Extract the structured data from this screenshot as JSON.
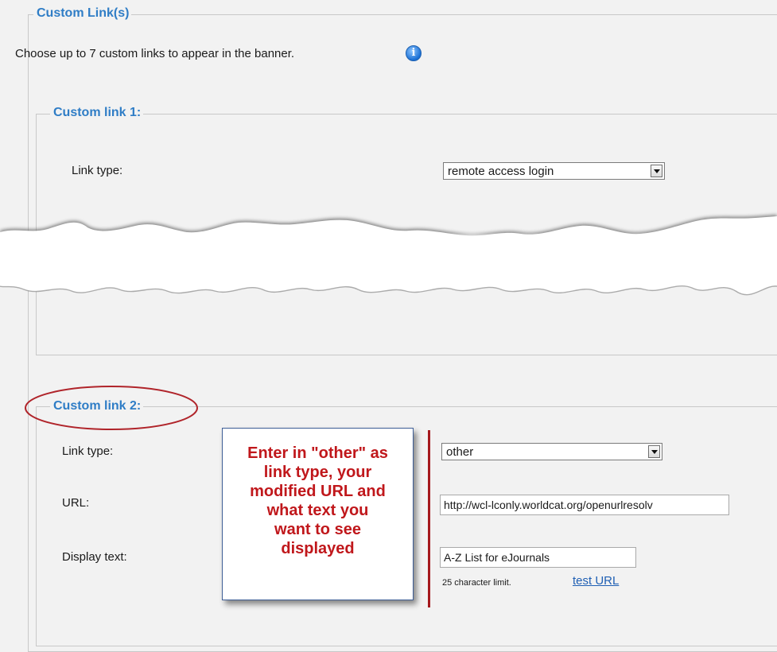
{
  "section": {
    "legend": "Custom Link(s)",
    "intro": "Choose up to 7 custom links to appear in the banner.",
    "info_icon": "info-icon"
  },
  "link1": {
    "legend": "Custom link 1:",
    "link_type_label": "Link type:",
    "link_type_value": "remote access login"
  },
  "link2": {
    "legend": "Custom link 2:",
    "link_type_label": "Link type:",
    "link_type_value": "other",
    "url_label": "URL:",
    "url_value": "http://wcl-lconly.worldcat.org/openurlresolv",
    "display_text_label": "Display text:",
    "display_text_value": "A-Z List for eJournals",
    "char_limit": "25 character limit.",
    "test_url": "test URL"
  },
  "callout": {
    "lines": [
      "Enter in \"other\" as",
      "link type, your",
      "modified URL and",
      "what text you",
      "want to see",
      "displayed"
    ]
  },
  "colors": {
    "legend_blue": "#2f7dc6",
    "callout_red": "#c0171b",
    "highlight_ellipse": "#b0242a"
  }
}
